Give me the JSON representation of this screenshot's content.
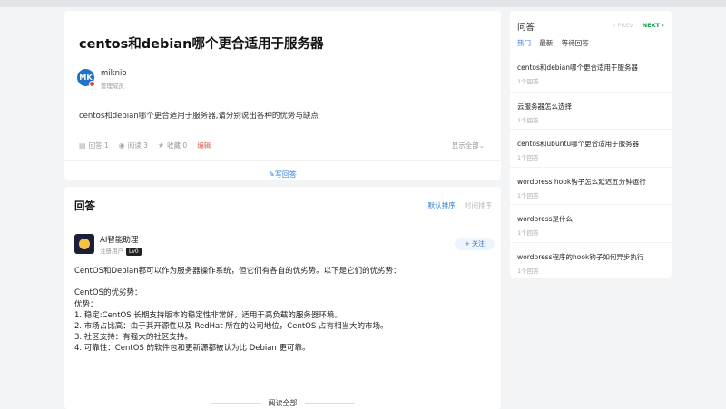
{
  "question": {
    "title": "centos和debian哪个更合适用于服务器",
    "author": {
      "avatar_text": "MK",
      "name": "miknio",
      "role": "管理成员"
    },
    "description": "centos和debian哪个更合适用于服务器,请分别说出各种的优势与缺点",
    "meta": {
      "answers": "回答 1",
      "views": "阅读 3",
      "favorites": "收藏 0",
      "edit": "编辑"
    },
    "show_all": "显示全部",
    "write_answer": "写回答"
  },
  "answers": {
    "heading": "回答",
    "sort_default": "默认排序",
    "sort_time": "时间排序",
    "author": {
      "name": "AI智能助理",
      "role": "注册用户",
      "level": "Lv0"
    },
    "follow": "+ 关注",
    "body": [
      "CentOS和Debian都可以作为服务器操作系统，但它们有各自的优劣势。以下是它们的优劣势：",
      "",
      "CentOS的优劣势：",
      "优势：",
      "1. 稳定:CentOS 长期支持版本的稳定性非常好，适用于高负载的服务器环境。",
      "2. 市场占比高：由于其开源性以及 RedHat 所在的公司地位，CentOS 占有相当大的市场。",
      "3. 社区支持：有强大的社区支持。",
      "4. 可靠性：CentOS 的软件包和更新源都被认为比 Debian 更可靠。"
    ],
    "read_all": "阅读全部"
  },
  "sidebar": {
    "title": "问答",
    "prev": "‹ PREV",
    "next": "NEXT ›",
    "tabs": [
      "热门",
      "最新",
      "等待回答"
    ],
    "items": [
      {
        "title": "centos和debian哪个更合适用于服务器",
        "count": "1个回答"
      },
      {
        "title": "云服务器怎么选择",
        "count": "1个回答"
      },
      {
        "title": "centos和ubuntu哪个更合适用于服务器",
        "count": "1个回答"
      },
      {
        "title": "wordpress hook钩子怎么延迟五分钟运行",
        "count": "1个回答"
      },
      {
        "title": "wordpress是什么",
        "count": "1个回答"
      },
      {
        "title": "wordpress程序的hook钩子如何异步执行",
        "count": "1个回答"
      }
    ]
  },
  "colors": {
    "accent": "#2a78d6",
    "next": "#16a34a",
    "edit": "#e05a4a"
  },
  "icons": [
    "comment-icon",
    "eye-icon",
    "star-icon",
    "leaf-pen-icon",
    "chevron-down-icon"
  ]
}
